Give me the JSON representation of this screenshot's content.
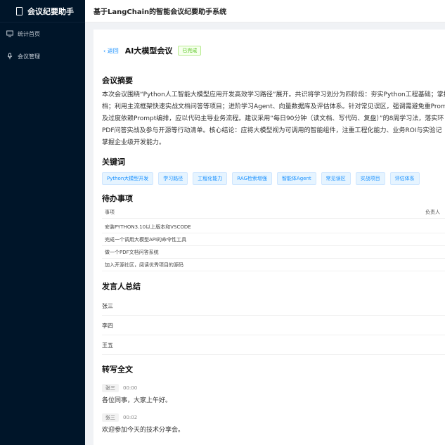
{
  "app": {
    "brand_title": "会议纪要助手",
    "header_title": "基于LangChain的智能会议纪要助手系统"
  },
  "sidebar": {
    "items": [
      {
        "label": "统计首页",
        "icon": "monitor-icon"
      },
      {
        "label": "会议管理",
        "icon": "microphone-icon"
      }
    ]
  },
  "page": {
    "back_label": "返回",
    "title": "AI大模型会议",
    "status": "已完成"
  },
  "sections": {
    "summary_title": "会议摘要",
    "keywords_title": "关键词",
    "todo_title": "待办事项",
    "speakers_title": "发言人总结",
    "transcript_title": "转写全文"
  },
  "summary_lines": [
    "本次会议围绕“Python人工智能大模型应用开发高效学习路径”展开。共识将学习划分为四阶段：夯实Python工程基础；掌握",
    "档；利用主流框架快速实战文档问答等项目；进阶学习Agent、向量数据库及评估体系。针对常见误区，强调需避免重Prom",
    "及过度依赖Prompt编排，应以代码主导业务流程。建议采用“每日90分钟（读文档、写代码、复盘）”的8周学习法，落实环",
    "PDF问答实战及参与开源等行动清单。核心结论：应将大模型视为可调用的智能组件，注重工程化能力、业务ROI与实验记",
    "掌握企业级开发能力。"
  ],
  "keywords": [
    "Python大模型开发",
    "学习路径",
    "工程化能力",
    "RAG检索增强",
    "智能体Agent",
    "常见误区",
    "实战项目",
    "评估体系"
  ],
  "todo": {
    "col_task": "事项",
    "col_owner": "负责人",
    "rows": [
      "安装PYTHON3.10以上版本和VSCODE",
      "完成一个调用大模型API的命令性工具",
      "做一个PDF文档问答系统",
      "加入开源社区，阅读优秀项目的源码"
    ]
  },
  "speakers": [
    "张三",
    "李四",
    "王五"
  ],
  "transcript": [
    {
      "speaker": "张三",
      "time": "00:00",
      "text": "各位同事，大家上午好。"
    },
    {
      "speaker": "张三",
      "time": "00:02",
      "text": "欢迎参加今天的技术分享会。"
    }
  ],
  "colors": {
    "sidebar_bg": "#001529",
    "accent": "#1890ff",
    "status_green": "#52c41a"
  }
}
